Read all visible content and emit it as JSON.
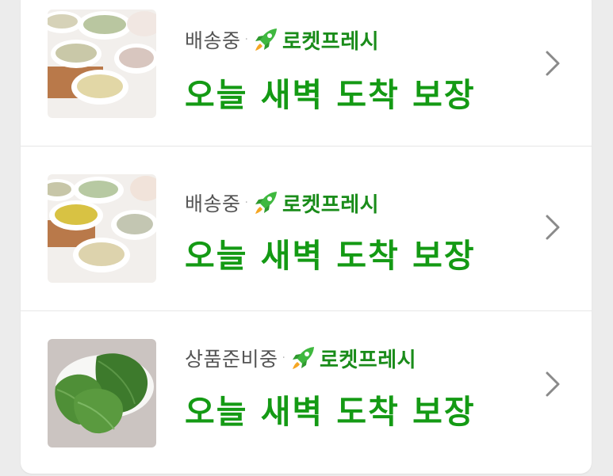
{
  "orders": [
    {
      "status": "배송중",
      "separator": "·",
      "badge_label": "로켓프레시",
      "headline": "오늘 새벽 도착 보장",
      "thumbnail_icon": "grain-bowls-image"
    },
    {
      "status": "배송중",
      "separator": "·",
      "badge_label": "로켓프레시",
      "headline": "오늘 새벽 도착 보장",
      "thumbnail_icon": "grain-bowls-image"
    },
    {
      "status": "상품준비중",
      "separator": "·",
      "badge_label": "로켓프레시",
      "headline": "오늘 새벽 도착 보장",
      "thumbnail_icon": "perilla-leaves-image"
    }
  ],
  "colors": {
    "brand_green": "#149a14",
    "badge_green": "#1a8c1a",
    "status_gray": "#555555",
    "chevron_gray": "#8a8a8a"
  }
}
